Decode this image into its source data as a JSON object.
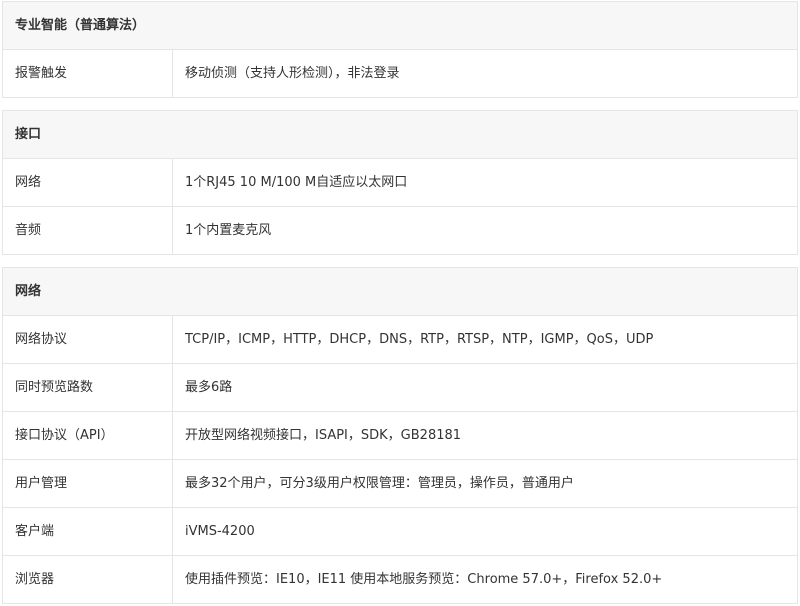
{
  "sections": [
    {
      "title": "专业智能（普通算法）",
      "rows": [
        {
          "label": "报警触发",
          "value": "移动侦测（支持人形检测），非法登录"
        }
      ]
    },
    {
      "title": "接口",
      "rows": [
        {
          "label": "网络",
          "value": "1个RJ45 10 M/100 M自适应以太网口"
        },
        {
          "label": "音频",
          "value": "1个内置麦克风"
        }
      ]
    },
    {
      "title": "网络",
      "rows": [
        {
          "label": "网络协议",
          "value": "TCP/IP，ICMP，HTTP，DHCP，DNS，RTP，RTSP，NTP，IGMP，QoS，UDP"
        },
        {
          "label": "同时预览路数",
          "value": "最多6路"
        },
        {
          "label": "接口协议（API）",
          "value": "开放型网络视频接口，ISAPI，SDK，GB28181"
        },
        {
          "label": "用户管理",
          "value": "最多32个用户，可分3级用户权限管理：管理员，操作员，普通用户"
        },
        {
          "label": "客户端",
          "value": "iVMS-4200"
        },
        {
          "label": "浏览器",
          "value": "使用插件预览：IE10，IE11 使用本地服务预览：Chrome 57.0+，Firefox 52.0+"
        }
      ]
    }
  ]
}
